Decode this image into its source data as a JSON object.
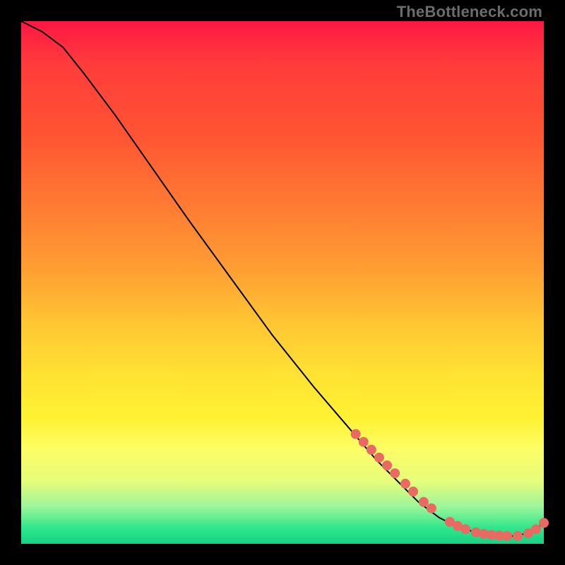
{
  "watermark": "TheBottleneck.com",
  "colors": {
    "dot": "#e86a63",
    "curve": "#000000"
  },
  "chart_data": {
    "type": "line",
    "title": "",
    "xlabel": "",
    "ylabel": "",
    "xlim": [
      0,
      100
    ],
    "ylim": [
      0,
      100
    ],
    "note": "Axes are unlabeled; values below are pixel-normalized 0–100 estimates read from the image (0 = left/bottom, 100 = right/top).",
    "series": [
      {
        "name": "bottleneck-curve",
        "x": [
          0,
          4,
          8,
          12,
          18,
          25,
          32,
          40,
          48,
          56,
          62,
          68,
          72,
          76,
          80,
          84,
          88,
          92,
          95,
          98,
          100
        ],
        "y": [
          100,
          98,
          95,
          90,
          82,
          72,
          62,
          51,
          40,
          30,
          23,
          16,
          12,
          8,
          5,
          3,
          2,
          1.5,
          1.5,
          2.5,
          4
        ]
      }
    ],
    "markers": {
      "name": "highlighted-points",
      "comment": "Salmon dots clustered on the lower-right portion of the curve.",
      "x": [
        64,
        65.5,
        67,
        68.5,
        70,
        71.5,
        73.5,
        75,
        77,
        78.5,
        82,
        83.5,
        85,
        87,
        88.5,
        90,
        91.5,
        93,
        95,
        97,
        98.5,
        100
      ],
      "y": [
        21,
        19.5,
        18,
        16.5,
        15,
        13.5,
        11.5,
        10,
        8,
        6.8,
        4.2,
        3.4,
        2.8,
        2.2,
        1.9,
        1.7,
        1.6,
        1.5,
        1.5,
        2,
        2.8,
        4
      ]
    }
  }
}
